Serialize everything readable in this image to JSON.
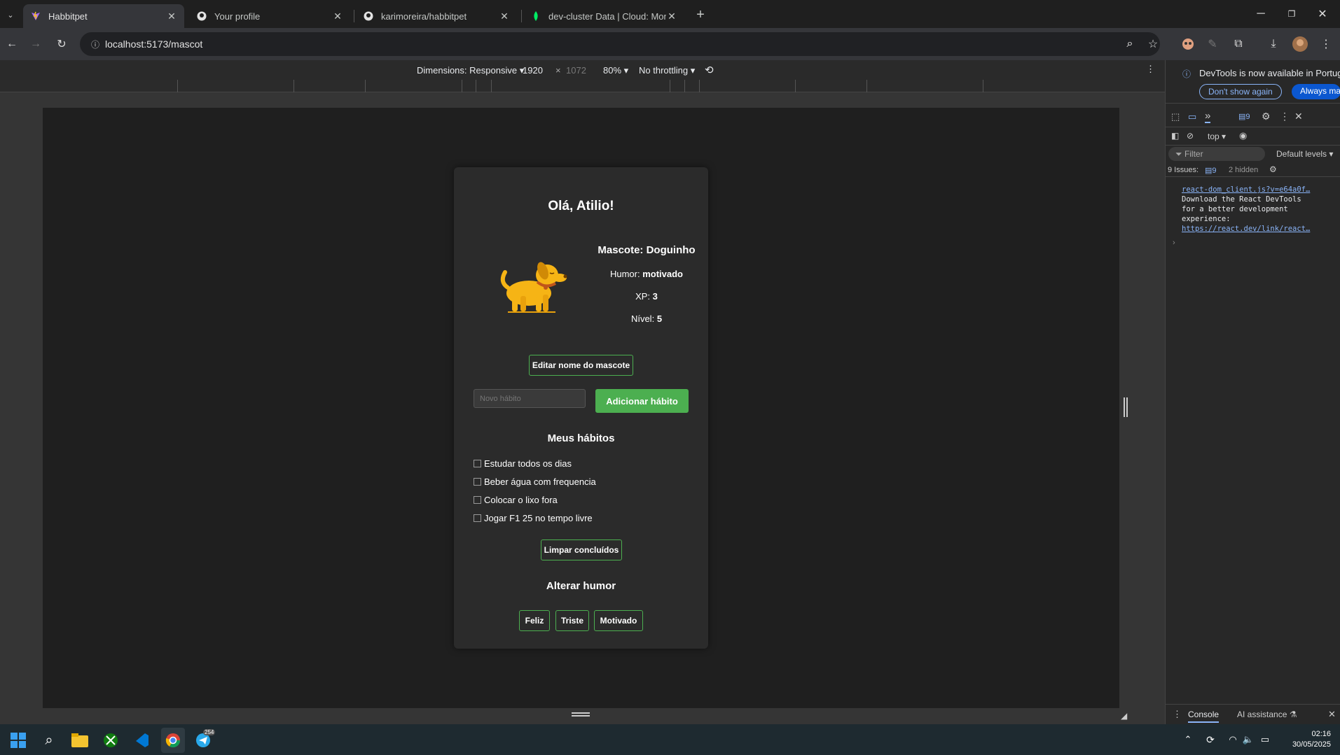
{
  "browser": {
    "tabs": [
      {
        "title": "Habbitpet",
        "active": true
      },
      {
        "title": "Your profile",
        "active": false
      },
      {
        "title": "karimoreira/habbitpet",
        "active": false
      },
      {
        "title": "dev-cluster Data | Cloud: Mong",
        "active": false
      }
    ],
    "url": "localhost:5173/mascot"
  },
  "device_bar": {
    "dimensions_label": "Dimensions: Responsive",
    "width": "1920",
    "height": "1072",
    "zoom": "80%",
    "throttling": "No throttling"
  },
  "app": {
    "greeting": "Olá, Atilio!",
    "pet_title": "Mascote: Doguinho",
    "mood_label": "Humor:",
    "mood_value": "motivado",
    "xp_label": "XP:",
    "xp_value": "3",
    "level_label": "Nível:",
    "level_value": "5",
    "edit_name_button": "Editar nome do mascote",
    "new_habit_placeholder": "Novo hábito",
    "add_habit_button": "Adicionar hábito",
    "habits_heading": "Meus hábitos",
    "habits": [
      {
        "label": "Estudar todos os dias",
        "checked": false
      },
      {
        "label": "Beber água com frequencia",
        "checked": false
      },
      {
        "label": "Colocar o lixo fora",
        "checked": false
      },
      {
        "label": "Jogar F1 25 no tempo livre",
        "checked": false
      }
    ],
    "clear_button": "Limpar concluídos",
    "mood_heading": "Alterar humor",
    "mood_buttons": [
      "Feliz",
      "Triste",
      "Motivado"
    ],
    "accent_color": "#4caf50"
  },
  "devtools": {
    "banner_text": "DevTools is now available in Portug",
    "dont_show": "Don't show again",
    "always_match": "Always mat",
    "issues_badge": "9",
    "context": "top",
    "filter_placeholder": "Filter",
    "levels": "Default levels",
    "issues_label": "9 Issues:",
    "issues_count": "9",
    "hidden": "2 hidden",
    "console_link": "react-dom_client.js?v=e64a0f…",
    "console_msg_1": "Download the React DevTools",
    "console_msg_2": "for a better development",
    "console_msg_3": "experience:",
    "console_url": "https://react.dev/link/react…",
    "tab_console": "Console",
    "tab_ai": "AI assistance"
  },
  "taskbar": {
    "time": "02:16",
    "date": "30/05/2025",
    "telegram_badge": "254"
  }
}
